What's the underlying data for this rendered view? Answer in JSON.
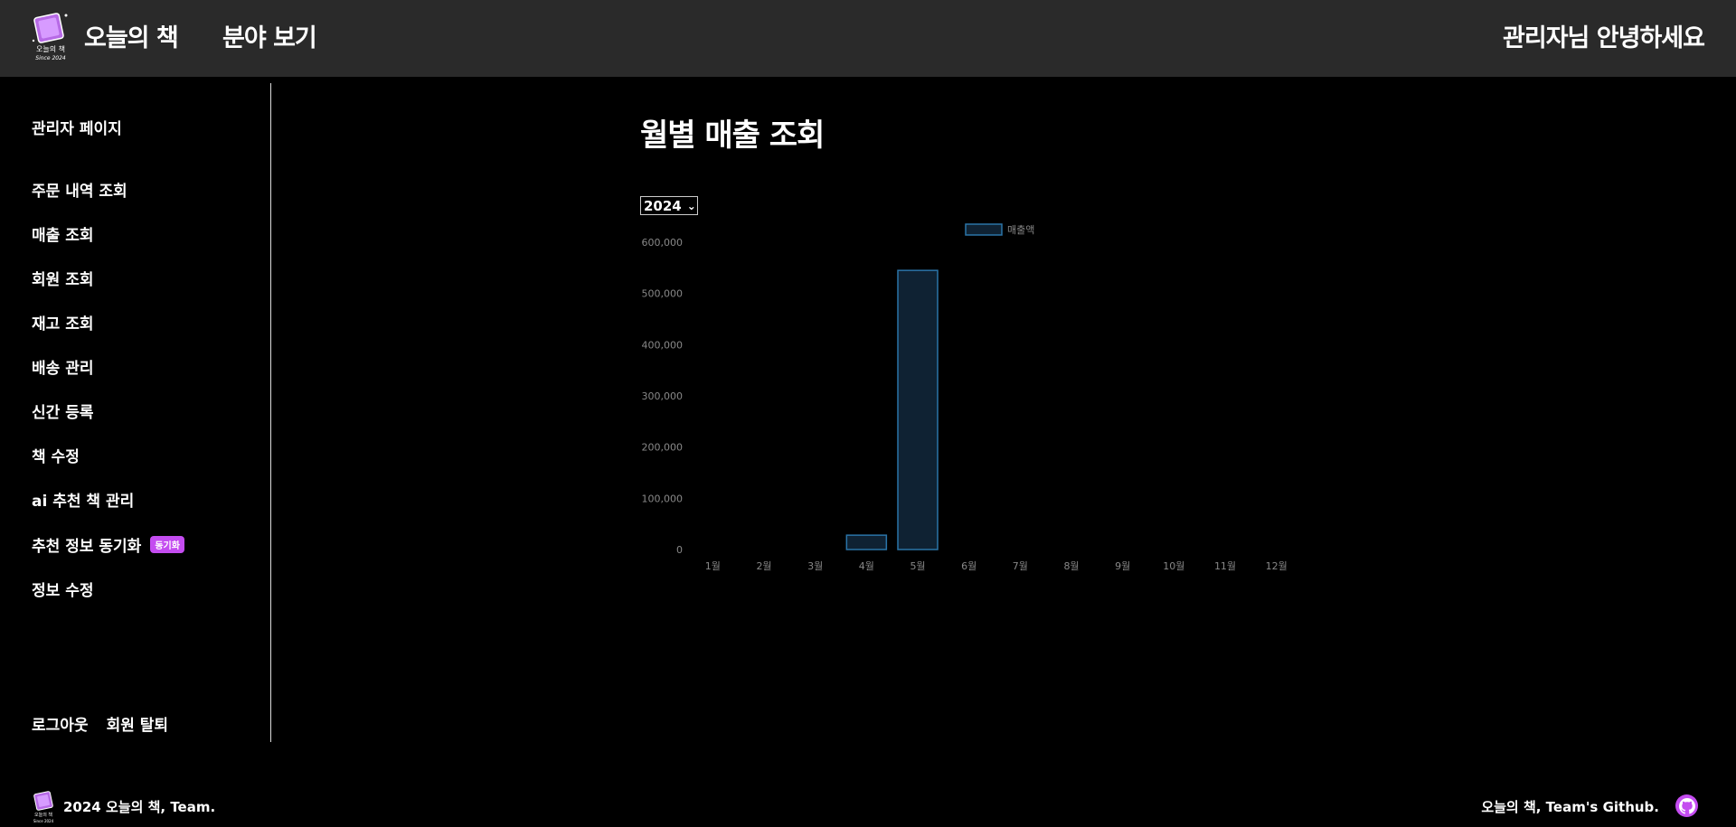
{
  "header": {
    "logo_text": "오늘의 책",
    "logo_subtext": "Since 2024",
    "brand": "오늘의 책",
    "nav_category": "분야 보기",
    "greeting": "관리자님 안녕하세요"
  },
  "sidebar": {
    "title": "관리자 페이지",
    "items": [
      {
        "label": "주문 내역 조회"
      },
      {
        "label": "매출 조회"
      },
      {
        "label": "회원 조회"
      },
      {
        "label": "재고 조회"
      },
      {
        "label": "배송 관리"
      },
      {
        "label": "신간 등록"
      },
      {
        "label": "책 수정"
      },
      {
        "label": "ai 추천 책 관리"
      },
      {
        "label": "추천 정보 동기화",
        "badge": "동기화"
      },
      {
        "label": "정보 수정"
      }
    ],
    "logout": "로그아웃",
    "withdraw": "회원 탈퇴"
  },
  "main": {
    "title": "월별 매출 조회",
    "year_select": "2024"
  },
  "chart_data": {
    "type": "bar",
    "categories": [
      "1월",
      "2월",
      "3월",
      "4월",
      "5월",
      "6월",
      "7월",
      "8월",
      "9월",
      "10월",
      "11월",
      "12월"
    ],
    "series": [
      {
        "name": "매출액",
        "values": [
          0,
          0,
          0,
          28000,
          545000,
          0,
          0,
          0,
          0,
          0,
          0,
          0
        ]
      }
    ],
    "ylim": [
      0,
      600000
    ],
    "yticks": [
      0,
      100000,
      200000,
      300000,
      400000,
      500000,
      600000
    ],
    "ytick_labels": [
      "0",
      "100,000",
      "200,000",
      "300,000",
      "400,000",
      "500,000",
      "600,000"
    ],
    "legend": "top-center",
    "bar_fill": "#0f2233",
    "bar_stroke": "#2a74a8",
    "tick_color": "#888888",
    "grid": false
  },
  "footer": {
    "left": "2024 오늘의 책, Team.",
    "right": "오늘의 책, Team's Github."
  },
  "colors": {
    "header_bg": "#2a2a2a",
    "accent": "#c44cf0"
  }
}
